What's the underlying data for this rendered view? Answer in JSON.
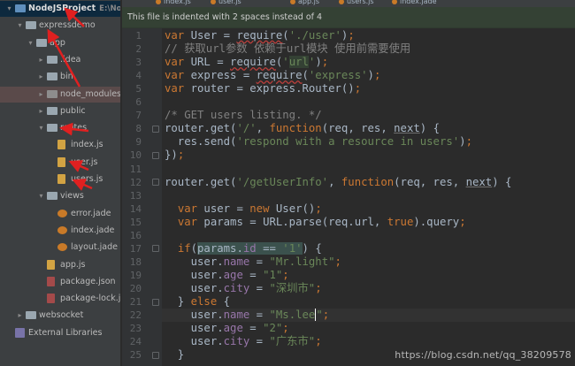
{
  "project_tree": {
    "items": [
      {
        "name": "NodeJSProject",
        "path": "E:\\NodeJSF",
        "level": 0,
        "type": "folder-root",
        "expanded": true
      },
      {
        "name": "expressdemo",
        "level": 1,
        "type": "folder",
        "expanded": true
      },
      {
        "name": "app",
        "level": 2,
        "type": "folder",
        "expanded": true
      },
      {
        "name": ".idea",
        "level": 3,
        "type": "folder",
        "expanded": false
      },
      {
        "name": "bin",
        "level": 3,
        "type": "folder",
        "expanded": false
      },
      {
        "name": "node_modules",
        "marker": "library root",
        "level": 3,
        "type": "folder-dark",
        "expanded": false,
        "highlight": true
      },
      {
        "name": "public",
        "level": 3,
        "type": "folder",
        "expanded": false
      },
      {
        "name": "routes",
        "level": 3,
        "type": "folder",
        "expanded": true
      },
      {
        "name": "index.js",
        "level": 4,
        "type": "js"
      },
      {
        "name": "user.js",
        "level": 4,
        "type": "js"
      },
      {
        "name": "users.js",
        "level": 4,
        "type": "js"
      },
      {
        "name": "views",
        "level": 3,
        "type": "folder",
        "expanded": true
      },
      {
        "name": "error.jade",
        "level": 4,
        "type": "jade"
      },
      {
        "name": "index.jade",
        "level": 4,
        "type": "jade"
      },
      {
        "name": "layout.jade",
        "level": 4,
        "type": "jade"
      },
      {
        "name": "app.js",
        "level": 3,
        "type": "js"
      },
      {
        "name": "package.json",
        "level": 3,
        "type": "json"
      },
      {
        "name": "package-lock.json",
        "level": 3,
        "type": "json"
      },
      {
        "name": "websocket",
        "level": 1,
        "type": "folder",
        "expanded": false
      },
      {
        "name": "External Libraries",
        "level": 0,
        "type": "lib"
      }
    ]
  },
  "editor": {
    "tabs": [
      "index.js",
      "user.js",
      "app.js",
      "users.js",
      "index.jade"
    ],
    "notice": "This file is indented with 2 spaces instead of 4",
    "current_line": 22,
    "lines": [
      {
        "n": 1,
        "html": "<span class=\"kw\">var</span> User = <span class=\"wavy\">require</span>(<span class=\"str\">'./user'</span>)<span class=\"kw\">;</span>"
      },
      {
        "n": 2,
        "html": "<span class=\"cmt\">// 获取url参数 依赖于url模块 使用前需要使用</span>"
      },
      {
        "n": 3,
        "html": "<span class=\"kw\">var</span> URL = <span class=\"wavy\">require</span>(<span class=\"str\">'<span class=\"hl\">url</span>'</span>)<span class=\"kw\">;</span>"
      },
      {
        "n": 4,
        "html": "<span class=\"kw\">var</span> express = <span class=\"wavy\">require</span>(<span class=\"str\">'express'</span>)<span class=\"kw\">;</span>"
      },
      {
        "n": 5,
        "html": "<span class=\"kw\">var</span> router = express.Router()<span class=\"kw\">;</span>"
      },
      {
        "n": 6,
        "html": ""
      },
      {
        "n": 7,
        "html": "<span class=\"cmt\">/* GET users listing. */</span>"
      },
      {
        "n": 8,
        "html": "router.get(<span class=\"str\">'/'</span>, <span class=\"kw\">function</span>(req, res, <span class=\"prm\">next</span>) {"
      },
      {
        "n": 9,
        "html": "  res.send(<span class=\"str\">'respond with a resource in users'</span>)<span class=\"kw\">;</span>"
      },
      {
        "n": 10,
        "html": "})<span class=\"kw\">;</span>"
      },
      {
        "n": 11,
        "html": ""
      },
      {
        "n": 12,
        "html": "router.get(<span class=\"str\">'/getUserInfo'</span>, <span class=\"kw\">function</span>(req, res, <span class=\"prm\">next</span>) {"
      },
      {
        "n": 13,
        "html": ""
      },
      {
        "n": 14,
        "html": "  <span class=\"kw\">var</span> user = <span class=\"kw\">new</span> User()<span class=\"kw\">;</span>"
      },
      {
        "n": 15,
        "html": "  <span class=\"kw\">var</span> params = URL.parse(req.url, <span class=\"kw\">true</span>).query<span class=\"kw\">;</span>"
      },
      {
        "n": 16,
        "html": ""
      },
      {
        "n": 17,
        "html": "  <span class=\"kw\">if</span>(<span class=\"sel\">params.<span class=\"prop\">id</span> == <span class=\"str\">'1'</span></span>) {"
      },
      {
        "n": 18,
        "html": "    user.<span class=\"prop\">name</span> = <span class=\"str\">\"Mr.light\"</span><span class=\"kw\">;</span>"
      },
      {
        "n": 19,
        "html": "    user.<span class=\"prop\">age</span> = <span class=\"str\">\"1\"</span><span class=\"kw\">;</span>"
      },
      {
        "n": 20,
        "html": "    user.<span class=\"prop\">city</span> = <span class=\"str\">\"深圳市\"</span><span class=\"kw\">;</span>"
      },
      {
        "n": 21,
        "html": "  } <span class=\"kw\">else</span> {"
      },
      {
        "n": 22,
        "html": "    user.<span class=\"prop\">name</span> = <span class=\"str\">\"Ms.lee<span class=\"caret\"></span>\"</span><span class=\"kw\">;</span>"
      },
      {
        "n": 23,
        "html": "    user.<span class=\"prop\">age</span> = <span class=\"str\">\"2\"</span><span class=\"kw\">;</span>"
      },
      {
        "n": 24,
        "html": "    user.<span class=\"prop\">city</span> = <span class=\"str\">\"广东市\"</span><span class=\"kw\">;</span>"
      },
      {
        "n": 25,
        "html": "  }"
      }
    ]
  },
  "watermark": "https://blog.csdn.net/qq_38209578",
  "colors": {
    "arrow": "#e02020",
    "keyword": "#cc7832",
    "string": "#6a8759"
  }
}
